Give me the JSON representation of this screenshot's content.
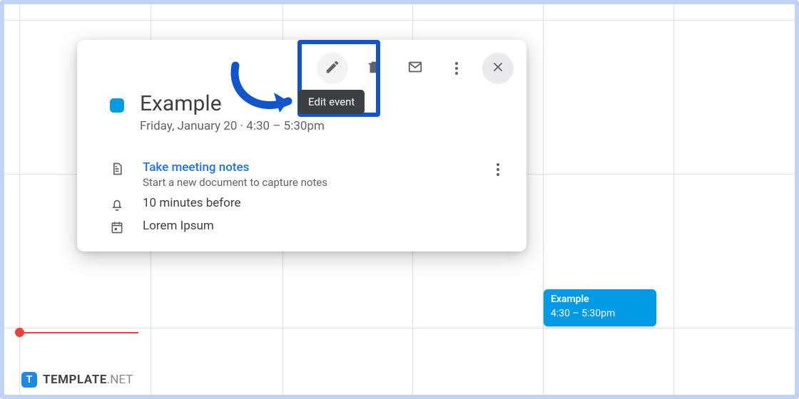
{
  "colors": {
    "accent": "#039be5",
    "annotation": "#1155cc",
    "now": "#ea4335",
    "link": "#1a73e8"
  },
  "popover": {
    "toolbar": {
      "edit_tooltip": "Edit event"
    },
    "title": "Example",
    "when": "Friday, January 20  ·  4:30 – 5:30pm",
    "notes": {
      "title": "Take meeting notes",
      "subtitle": "Start a new document to capture notes"
    },
    "reminder": "10 minutes before",
    "calendar": "Lorem Ipsum"
  },
  "grid_event": {
    "title": "Example",
    "time": "4:30 – 5:30pm"
  },
  "footer": {
    "badge": "T",
    "brand_bold": "TEMPLATE",
    "brand_light": ".NET"
  }
}
